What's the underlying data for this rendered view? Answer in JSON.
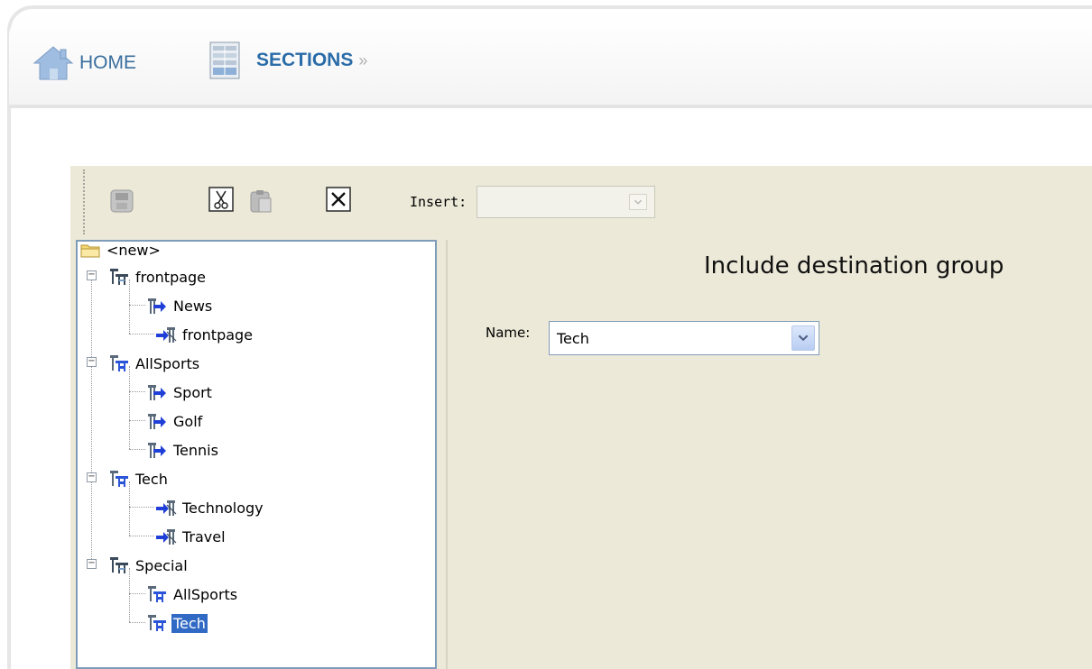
{
  "nav": {
    "home_label": "HOME",
    "sections_label": "SECTIONS",
    "separator": "»"
  },
  "toolbar": {
    "insert_label": "Insert:",
    "insert_value": "",
    "buttons": [
      "save-icon",
      "cut-icon",
      "paste-icon",
      "delete-icon"
    ]
  },
  "tree": {
    "items": [
      {
        "label": "<new>",
        "icon": "folder-icon"
      },
      {
        "label": "frontpage",
        "icon": "section-group-icon",
        "expanded": true
      },
      {
        "label": "News",
        "icon": "section-include-icon"
      },
      {
        "label": "frontpage",
        "icon": "section-exclude-icon"
      },
      {
        "label": "AllSports",
        "icon": "destination-group-icon",
        "expanded": true
      },
      {
        "label": "Sport",
        "icon": "section-include-icon"
      },
      {
        "label": "Golf",
        "icon": "section-include-icon"
      },
      {
        "label": "Tennis",
        "icon": "section-include-icon"
      },
      {
        "label": "Tech",
        "icon": "destination-group-icon",
        "expanded": true
      },
      {
        "label": "Technology",
        "icon": "section-exclude-icon"
      },
      {
        "label": "Travel",
        "icon": "section-exclude-icon"
      },
      {
        "label": "Special",
        "icon": "section-group-icon",
        "expanded": true
      },
      {
        "label": "AllSports",
        "icon": "destination-group-icon"
      },
      {
        "label": "Tech",
        "icon": "destination-group-icon",
        "selected": true
      }
    ]
  },
  "content": {
    "title": "Include destination group",
    "name_label": "Name:",
    "name_value": "Tech"
  },
  "colors": {
    "panel_bg": "#ece9d8",
    "selection": "#316ac5",
    "nav_link": "#2a6ca8",
    "border": "#7f9db9"
  }
}
